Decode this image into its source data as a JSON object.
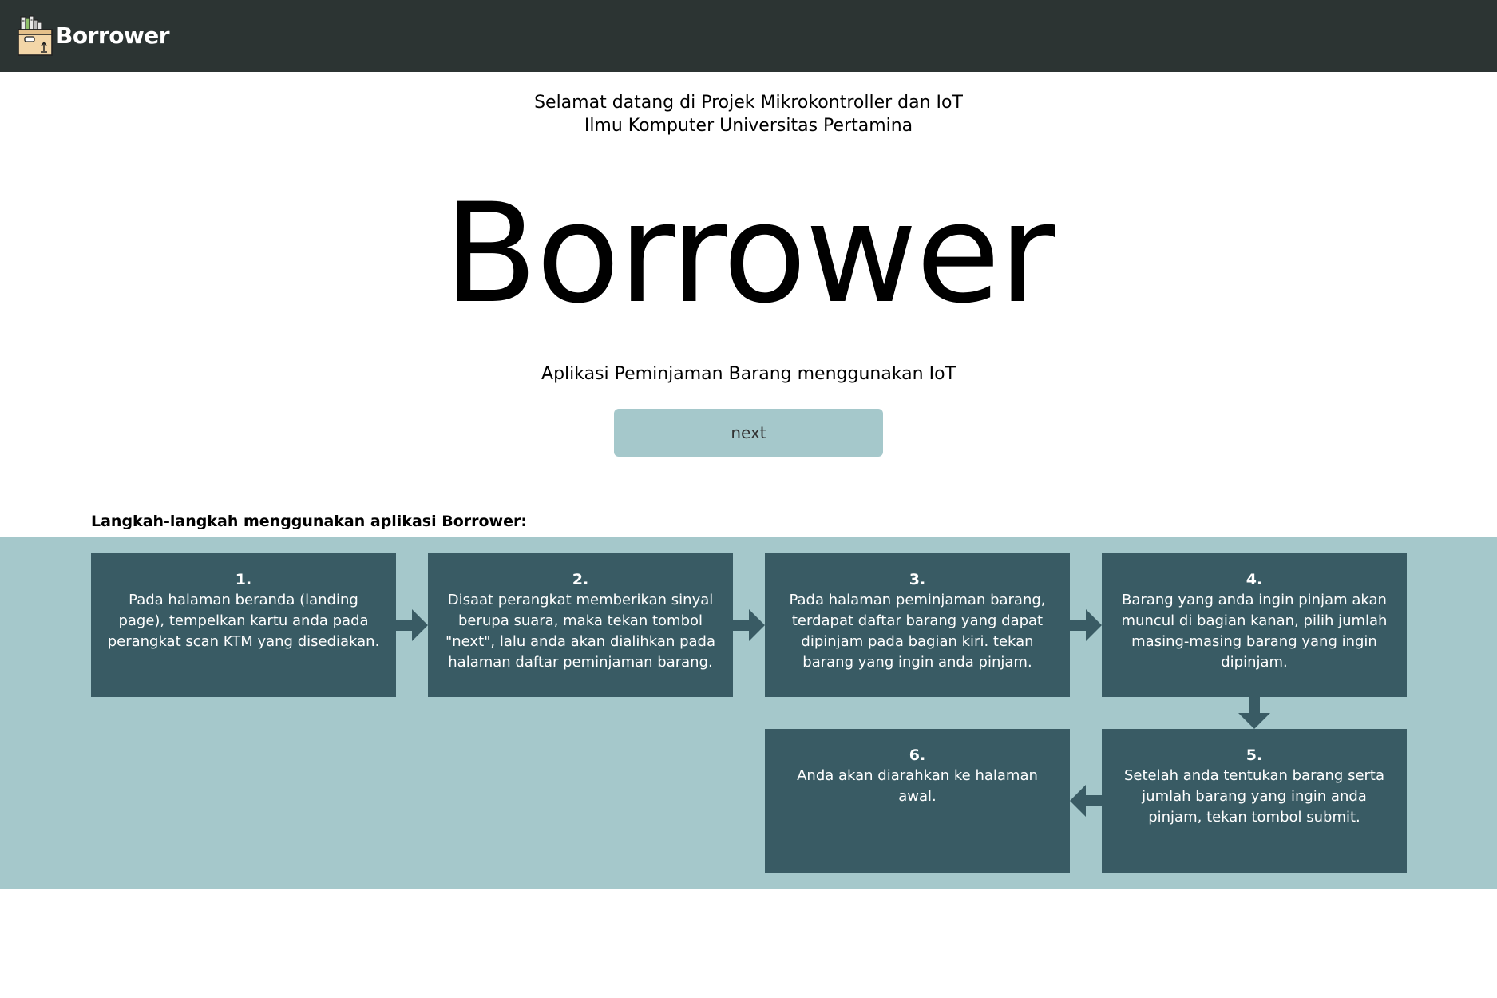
{
  "navbar": {
    "brand_name": "Borrower",
    "logo_icon": "box-with-books-icon",
    "background_color": "#2c3433"
  },
  "hero": {
    "welcome_line_1": "Selamat datang di Projek Mikrokontroller dan IoT",
    "welcome_line_2": "Ilmu Komputer Universitas Pertamina",
    "title": "Borrower",
    "subtitle": "Aplikasi Peminjaman Barang menggunakan IoT",
    "next_button_label": "next",
    "button_color": "#a5c8cb"
  },
  "steps": {
    "heading": "Langkah-langkah menggunakan aplikasi Borrower:",
    "section_color": "#a5c8cb",
    "card_color": "#395b64",
    "items": [
      {
        "number": "1.",
        "text": "Pada halaman beranda (landing page), tempelkan kartu anda pada perangkat scan KTM yang disediakan."
      },
      {
        "number": "2.",
        "text": "Disaat perangkat memberikan sinyal berupa suara, maka tekan tombol \"next\", lalu anda akan dialihkan pada halaman daftar peminjaman barang."
      },
      {
        "number": "3.",
        "text": "Pada halaman peminjaman barang, terdapat daftar barang yang dapat dipinjam pada bagian kiri. tekan barang yang ingin anda pinjam."
      },
      {
        "number": "4.",
        "text": "Barang yang anda ingin pinjam akan muncul di bagian kanan, pilih jumlah masing-masing barang yang ingin dipinjam."
      },
      {
        "number": "5.",
        "text": "Setelah anda tentukan barang serta jumlah barang yang ingin anda pinjam, tekan tombol submit."
      },
      {
        "number": "6.",
        "text": "Anda akan diarahkan ke halaman awal."
      }
    ]
  }
}
